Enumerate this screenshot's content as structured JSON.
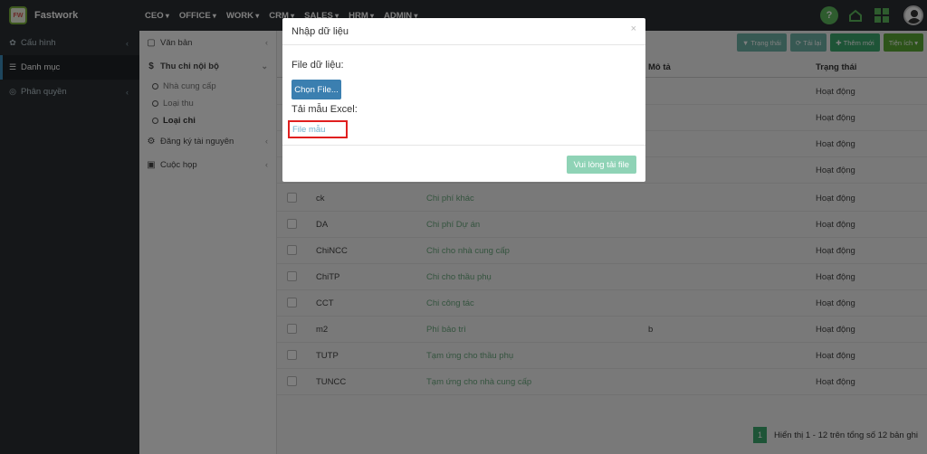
{
  "brand": {
    "logo_text": "FW",
    "name": "Fastwork"
  },
  "top_menu": [
    "CEO",
    "OFFICE",
    "WORK",
    "CRM",
    "SALES",
    "HRM",
    "ADMIN"
  ],
  "left_nav": [
    {
      "label": "Cấu hình",
      "icon": "gear-icon"
    },
    {
      "label": "Danh mục",
      "icon": "list-icon"
    },
    {
      "label": "Phân quyền",
      "icon": "shield-icon"
    }
  ],
  "sub_nav": {
    "van_ban": "Văn bản",
    "thu_chi": "Thu chi nội bộ",
    "children": [
      "Nhà cung cấp",
      "Loại thu",
      "Loại chi"
    ],
    "dang_ky": "Đăng ký tài nguyên",
    "cuoc_hop": "Cuộc họp"
  },
  "toolbar": {
    "status": "Trạng thái",
    "reload": "Tải lại",
    "add": "Thêm mới",
    "utility": "Tiện ích"
  },
  "table": {
    "headers": {
      "desc": "Mô tả",
      "status": "Trạng thái"
    },
    "top_statuses": [
      "Hoạt động",
      "Hoạt động",
      "Hoạt động",
      "Hoạt động"
    ],
    "rows": [
      {
        "code": "ck",
        "name": "Chi phí khác",
        "desc": "",
        "status": "Hoạt động"
      },
      {
        "code": "DA",
        "name": "Chi phí Dự án",
        "desc": "",
        "status": "Hoạt động"
      },
      {
        "code": "ChiNCC",
        "name": "Chi cho nhà cung cấp",
        "desc": "",
        "status": "Hoạt động"
      },
      {
        "code": "ChiTP",
        "name": "Chi cho thầu phụ",
        "desc": "",
        "status": "Hoạt động"
      },
      {
        "code": "CCT",
        "name": "Chi công tác",
        "desc": "",
        "status": "Hoạt động"
      },
      {
        "code": "m2",
        "name": "Phí bảo trì",
        "desc": "b",
        "status": "Hoạt động"
      },
      {
        "code": "TUTP",
        "name": "Tạm ứng cho thầu phụ",
        "desc": "",
        "status": "Hoạt động"
      },
      {
        "code": "TUNCC",
        "name": "Tạm ứng cho nhà cung cấp",
        "desc": "",
        "status": "Hoạt động"
      }
    ]
  },
  "pagination": {
    "page": "1",
    "info": "Hiển thị 1 - 12 trên tổng số 12 bản ghi"
  },
  "modal": {
    "title": "Nhập dữ liệu",
    "close": "×",
    "file_label": "File dữ liệu:",
    "choose_button": "Chọn File...",
    "template_label": "Tải mẫu Excel:",
    "template_link": "File mẫu",
    "upload_button": "Vui lòng tải file"
  },
  "colors": {
    "sidebar": "#2b2f33",
    "accent_green": "#3ca86e",
    "link_green": "#6aa87e",
    "primary_blue": "#3b7fb0",
    "highlight_red": "#e02020"
  }
}
